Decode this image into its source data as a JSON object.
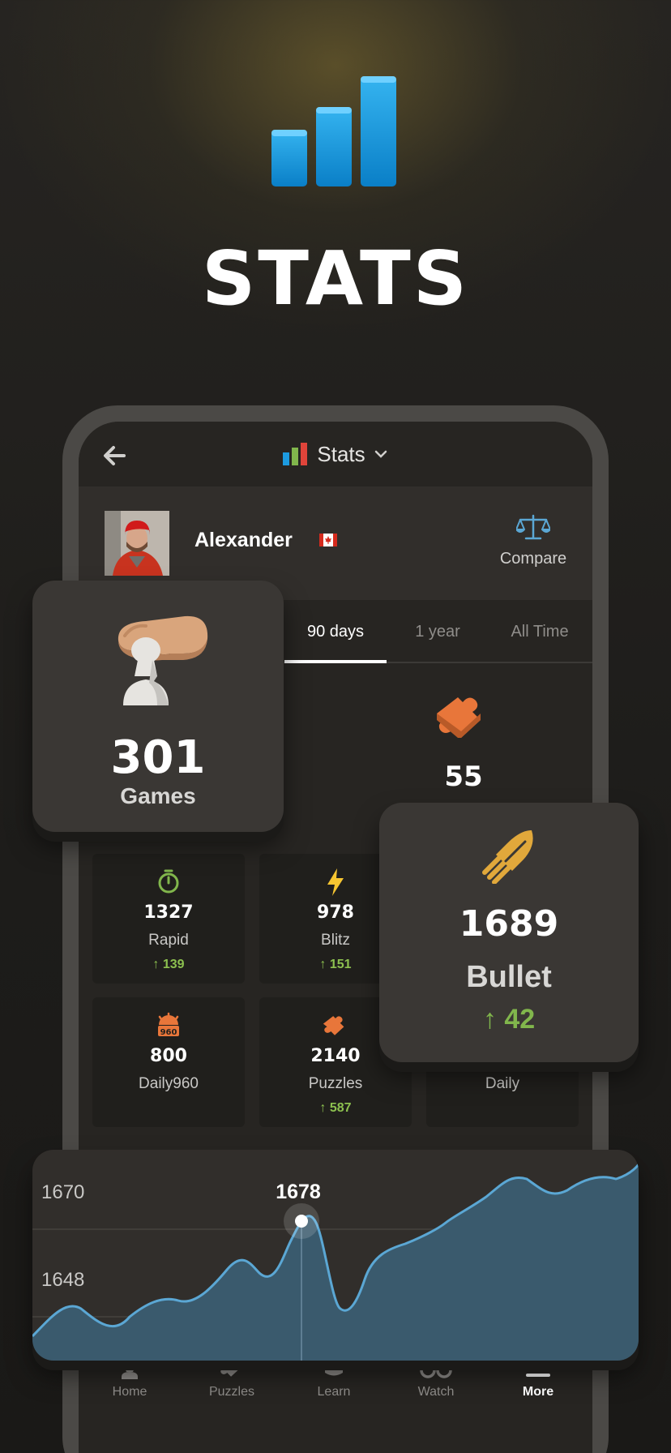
{
  "hero": {
    "title": "STATS"
  },
  "header": {
    "title": "Stats"
  },
  "profile": {
    "name": "Alexander",
    "country": "Canada",
    "compare_label": "Compare"
  },
  "tabs": [
    {
      "label": "90 days",
      "active": true
    },
    {
      "label": "1 year",
      "active": false
    },
    {
      "label": "All Time",
      "active": false
    }
  ],
  "summary": {
    "puzzles_count": "55"
  },
  "games_card": {
    "count": "301",
    "label": "Games"
  },
  "stat_cards": [
    {
      "label": "Rapid",
      "value": "1327",
      "change": "139",
      "icon": "timer-icon"
    },
    {
      "label": "Blitz",
      "value": "978",
      "change": "151",
      "icon": "lightning-icon"
    },
    {
      "label": "Daily960",
      "value": "800",
      "change": "",
      "icon": "daily960-icon"
    },
    {
      "label": "Puzzles",
      "value": "2140",
      "change": "587",
      "icon": "puzzle-icon"
    },
    {
      "label": "Daily",
      "value": "",
      "change": "",
      "icon": "sun-icon"
    }
  ],
  "bullet_card": {
    "rating": "1689",
    "label": "Bullet",
    "change": "42"
  },
  "rating_chart": {
    "highlight_label": "1678",
    "y_labels": [
      "1670",
      "1648"
    ],
    "colors": {
      "fill": "#3a5a6d",
      "line": "#5ba7d4"
    }
  },
  "bottom_nav": [
    {
      "label": "Home",
      "icon": "pawn-icon",
      "active": false
    },
    {
      "label": "Puzzles",
      "icon": "puzzle-icon",
      "active": false
    },
    {
      "label": "Learn",
      "icon": "graduation-cap-icon",
      "active": false
    },
    {
      "label": "Watch",
      "icon": "binoculars-icon",
      "active": false
    },
    {
      "label": "More",
      "icon": "menu-icon",
      "active": true
    }
  ],
  "colors": {
    "accent_green": "#81b64c",
    "brand_blue": "#1d9be0"
  }
}
